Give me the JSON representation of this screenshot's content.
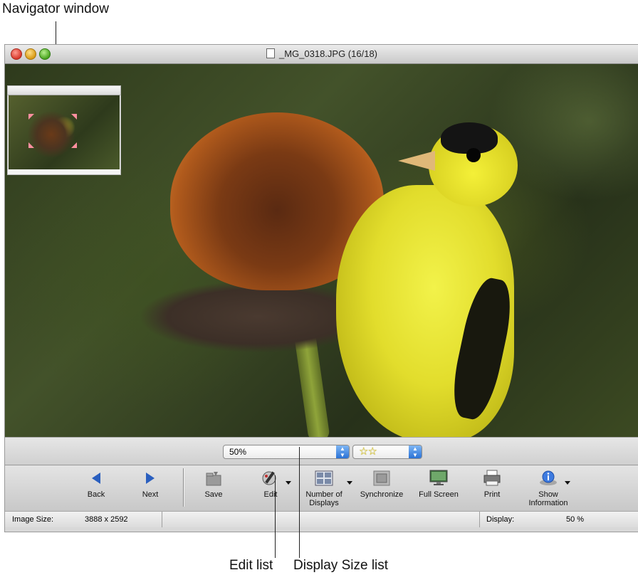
{
  "annotations": {
    "navigator": "Navigator window",
    "edit_list": "Edit list",
    "display_size_list": "Display Size list"
  },
  "window": {
    "title": "_MG_0318.JPG (16/18)"
  },
  "controls": {
    "display_size_value": "50%",
    "rating_stars": "☆☆"
  },
  "toolbar": {
    "items": [
      {
        "label": "Back",
        "icon": "left-arrow-icon"
      },
      {
        "label": "Next",
        "icon": "right-arrow-icon"
      },
      {
        "label": "Save",
        "icon": "save-folder-icon"
      },
      {
        "label": "Edit",
        "icon": "edit-tools-icon"
      },
      {
        "label": "Number of\nDisplays",
        "icon": "number-of-displays-icon"
      },
      {
        "label": "Synchronize",
        "icon": "synchronize-icon"
      },
      {
        "label": "Full Screen",
        "icon": "monitor-icon"
      },
      {
        "label": "Print",
        "icon": "printer-icon"
      },
      {
        "label": "Show\nInformation",
        "icon": "info-icon"
      }
    ]
  },
  "status": {
    "image_size_label": "Image Size:",
    "image_size_value": "3888 x 2592",
    "display_label": "Display:",
    "display_value": "50 %"
  },
  "colors": {
    "accent_blue": "#2b72d6",
    "nav_arrow_blue": "#2a5fbf",
    "star_yellow": "#f1dd36"
  }
}
